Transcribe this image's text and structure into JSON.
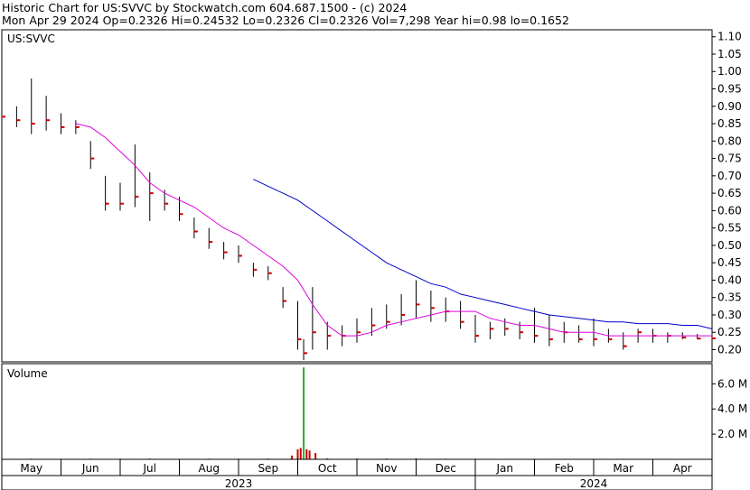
{
  "header": {
    "line1": "Historic Chart for US:SVVC by Stockwatch.com 604.687.1500 - (c) 2024",
    "line2": "Mon Apr 29 2024   Op=0.2326   Hi=0.24532   Lo=0.2326   Cl=0.2326   Vol=7,298   Year hi=0.98   lo=0.1652"
  },
  "colors": {
    "price": "#cc0000",
    "bar_stem": "#000000",
    "ma_short": "#dd00dd",
    "ma_long": "#0000cc",
    "volume": "#33aa33",
    "volume_red": "#cc0000",
    "grid": "#cccccc"
  },
  "chart_data": [
    {
      "type": "line",
      "panel": "price",
      "symbol_label": "US:SVVC",
      "y_ticks": [
        "1.10",
        "1.05",
        "1.00",
        "0.95",
        "0.90",
        "0.85",
        "0.80",
        "0.75",
        "0.70",
        "0.65",
        "0.60",
        "0.55",
        "0.50",
        "0.45",
        "0.40",
        "0.35",
        "0.30",
        "0.25",
        "0.20"
      ],
      "ylim": [
        0.165,
        1.12
      ],
      "x_month_labels": [
        "May",
        "Jun",
        "Jul",
        "Aug",
        "Sep",
        "Oct",
        "Nov",
        "Dec",
        "Jan",
        "Feb",
        "Mar",
        "Apr"
      ],
      "x_year_labels": [
        "2023",
        "2024"
      ],
      "x_range": [
        0,
        12
      ],
      "series": [
        {
          "kind": "close",
          "x": [
            0.0,
            0.25,
            0.5,
            0.75,
            1.0,
            1.25,
            1.5,
            1.75,
            2.0,
            2.25,
            2.5,
            2.75,
            3.0,
            3.25,
            3.5,
            3.75,
            4.0,
            4.25,
            4.5,
            4.75,
            5.0,
            5.1,
            5.25,
            5.5,
            5.75,
            6.0,
            6.25,
            6.5,
            6.75,
            7.0,
            7.25,
            7.5,
            7.75,
            8.0,
            8.25,
            8.5,
            8.75,
            9.0,
            9.25,
            9.5,
            9.75,
            10.0,
            10.25,
            10.5,
            10.75,
            11.0,
            11.25,
            11.5,
            11.75,
            12.0
          ],
          "y": [
            0.87,
            0.86,
            0.85,
            0.86,
            0.84,
            0.84,
            0.75,
            0.62,
            0.62,
            0.64,
            0.65,
            0.62,
            0.59,
            0.54,
            0.51,
            0.48,
            0.47,
            0.43,
            0.42,
            0.34,
            0.23,
            0.19,
            0.25,
            0.24,
            0.24,
            0.25,
            0.27,
            0.28,
            0.3,
            0.33,
            0.32,
            0.31,
            0.28,
            0.24,
            0.26,
            0.26,
            0.25,
            0.24,
            0.23,
            0.25,
            0.23,
            0.23,
            0.23,
            0.21,
            0.25,
            0.24,
            0.24,
            0.235,
            0.232,
            0.2326
          ]
        },
        {
          "kind": "high",
          "y": [
            0.91,
            0.9,
            0.98,
            0.93,
            0.88,
            0.86,
            0.8,
            0.7,
            0.68,
            0.79,
            0.71,
            0.66,
            0.64,
            0.58,
            0.55,
            0.51,
            0.5,
            0.45,
            0.44,
            0.38,
            0.34,
            0.23,
            0.38,
            0.28,
            0.27,
            0.29,
            0.32,
            0.33,
            0.36,
            0.4,
            0.37,
            0.35,
            0.34,
            0.3,
            0.28,
            0.29,
            0.28,
            0.32,
            0.3,
            0.28,
            0.27,
            0.29,
            0.26,
            0.25,
            0.26,
            0.26,
            0.25,
            0.25,
            0.245,
            0.2453
          ]
        },
        {
          "kind": "low",
          "y": [
            0.84,
            0.84,
            0.82,
            0.83,
            0.82,
            0.82,
            0.72,
            0.6,
            0.6,
            0.61,
            0.57,
            0.6,
            0.57,
            0.52,
            0.49,
            0.46,
            0.45,
            0.41,
            0.4,
            0.32,
            0.2,
            0.17,
            0.2,
            0.2,
            0.21,
            0.22,
            0.24,
            0.26,
            0.27,
            0.29,
            0.28,
            0.28,
            0.26,
            0.22,
            0.23,
            0.24,
            0.23,
            0.22,
            0.21,
            0.22,
            0.22,
            0.21,
            0.22,
            0.2,
            0.22,
            0.22,
            0.22,
            0.23,
            0.23,
            0.2326
          ]
        },
        {
          "kind": "ma_short",
          "x": [
            1.25,
            1.5,
            1.75,
            2.0,
            2.25,
            2.5,
            2.75,
            3.0,
            3.25,
            3.5,
            3.75,
            4.0,
            4.25,
            4.5,
            4.75,
            5.0,
            5.25,
            5.5,
            5.75,
            6.0,
            6.25,
            6.5,
            6.75,
            7.0,
            7.25,
            7.5,
            7.75,
            8.0,
            8.25,
            8.5,
            8.75,
            9.0,
            9.25,
            9.5,
            9.75,
            10.0,
            10.25,
            10.5,
            10.75,
            11.0,
            11.25,
            11.5,
            11.75,
            12.0
          ],
          "y": [
            0.85,
            0.84,
            0.81,
            0.77,
            0.73,
            0.68,
            0.65,
            0.63,
            0.61,
            0.58,
            0.55,
            0.53,
            0.5,
            0.47,
            0.44,
            0.4,
            0.33,
            0.27,
            0.24,
            0.24,
            0.25,
            0.27,
            0.28,
            0.29,
            0.3,
            0.31,
            0.31,
            0.31,
            0.29,
            0.28,
            0.27,
            0.27,
            0.26,
            0.25,
            0.25,
            0.25,
            0.24,
            0.24,
            0.24,
            0.24,
            0.24,
            0.24,
            0.24,
            0.24
          ]
        },
        {
          "kind": "ma_long",
          "x": [
            4.25,
            4.5,
            4.75,
            5.0,
            5.25,
            5.5,
            5.75,
            6.0,
            6.25,
            6.5,
            6.75,
            7.0,
            7.25,
            7.5,
            7.75,
            8.0,
            8.25,
            8.5,
            8.75,
            9.0,
            9.25,
            9.5,
            9.75,
            10.0,
            10.25,
            10.5,
            10.75,
            11.0,
            11.25,
            11.5,
            11.75,
            12.0
          ],
          "y": [
            0.69,
            0.67,
            0.65,
            0.63,
            0.6,
            0.57,
            0.54,
            0.51,
            0.48,
            0.45,
            0.43,
            0.41,
            0.39,
            0.38,
            0.36,
            0.35,
            0.34,
            0.33,
            0.32,
            0.31,
            0.3,
            0.295,
            0.29,
            0.285,
            0.28,
            0.28,
            0.275,
            0.275,
            0.275,
            0.27,
            0.27,
            0.26
          ]
        }
      ]
    },
    {
      "type": "bar",
      "panel": "volume",
      "title": "Volume",
      "y_ticks": [
        "6.0 M",
        "4.0 M",
        "2.0 M"
      ],
      "ylim": [
        0,
        7.6
      ],
      "x": [
        0.5,
        1.0,
        1.5,
        2.0,
        2.5,
        3.0,
        3.5,
        4.0,
        4.5,
        4.9,
        5.0,
        5.05,
        5.1,
        5.15,
        5.2,
        5.3,
        5.5,
        6.0,
        6.5,
        7.0,
        7.5,
        8.0,
        8.5,
        9.0,
        9.5,
        10.0,
        10.5,
        11.0,
        11.5
      ],
      "values": [
        0.05,
        0.04,
        0.05,
        0.05,
        0.06,
        0.04,
        0.05,
        0.05,
        0.06,
        0.3,
        0.8,
        0.9,
        7.3,
        0.8,
        0.7,
        0.5,
        0.08,
        0.06,
        0.06,
        0.07,
        0.05,
        0.05,
        0.04,
        0.05,
        0.04,
        0.04,
        0.04,
        0.03,
        0.03
      ]
    }
  ]
}
